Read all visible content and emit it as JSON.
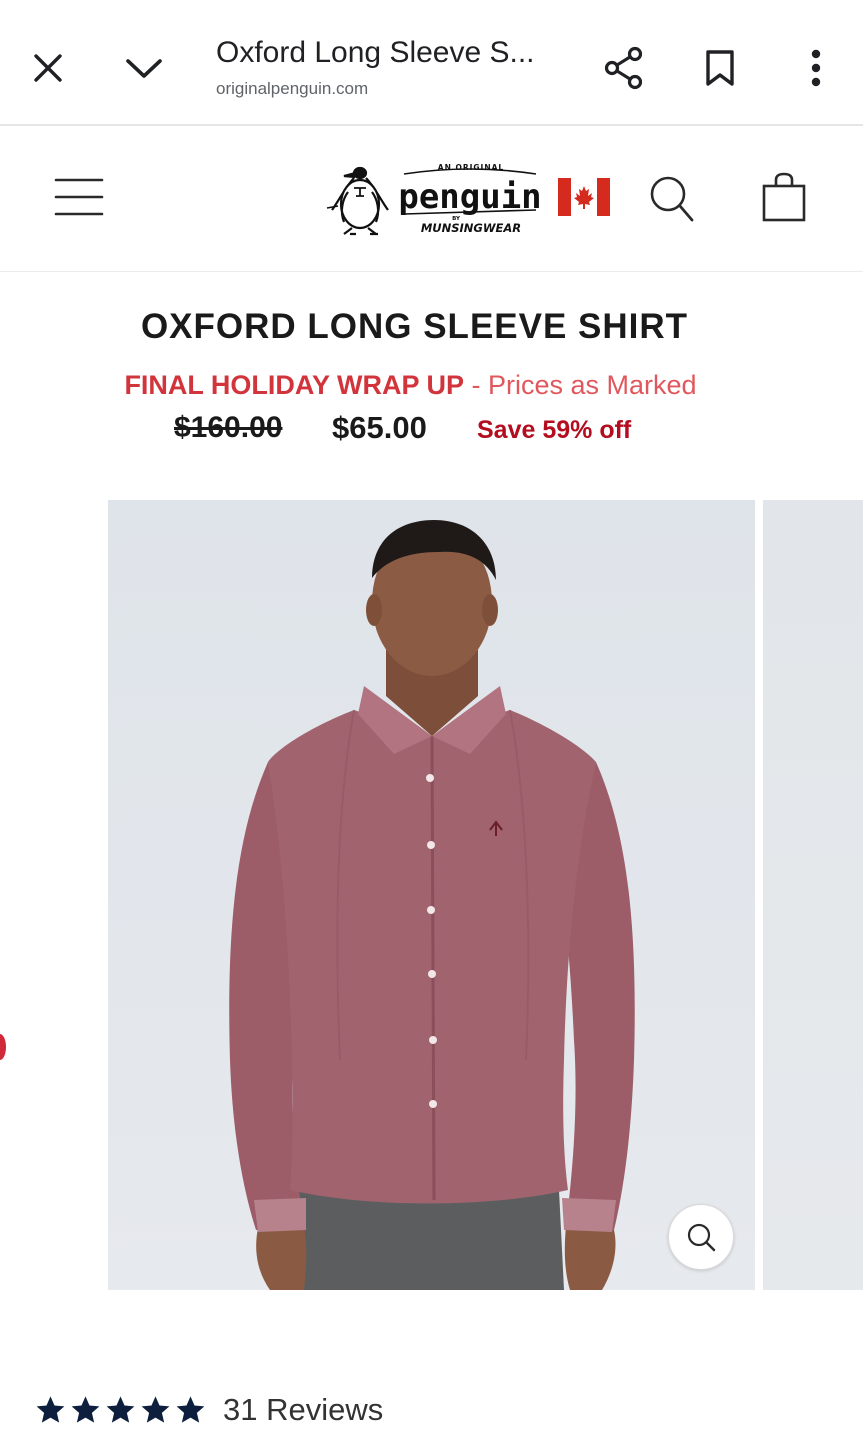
{
  "browser": {
    "title": "Oxford Long Sleeve S...",
    "url": "originalpenguin.com"
  },
  "header": {
    "logo_top": "AN ORIGINAL",
    "logo_main": "penguin",
    "logo_by": "BY",
    "logo_bottom": "MUNSINGWEAR",
    "icons": [
      "menu-icon",
      "canada-flag-icon",
      "search-icon",
      "shopping-bag-icon"
    ]
  },
  "product": {
    "title": "OXFORD LONG SLEEVE SHIRT",
    "promo_name": "FINAL HOLIDAY WRAP UP",
    "promo_suffix": " - Prices as Marked",
    "original_price": "$160.00",
    "sale_price": "$65.00",
    "savings": "Save 59% off",
    "shirt_color": "#a1646f"
  },
  "reviews": {
    "rating": 5,
    "max_rating": 5,
    "label": "31 Reviews"
  },
  "colors": {
    "promo_red": "#d2343c",
    "save_red": "#b30d1f",
    "star_navy": "#0d1f3c",
    "flag_red": "#d52b1e"
  }
}
